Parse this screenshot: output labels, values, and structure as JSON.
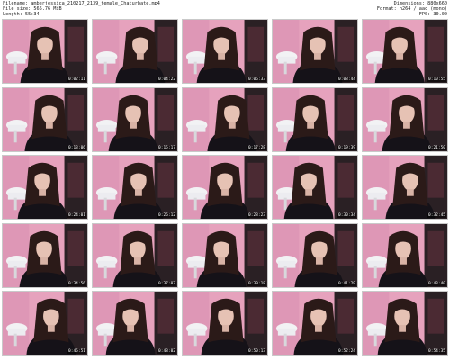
{
  "info": {
    "filename": "Filename: amberjessica_210217_2139_female_Chaturbate.mp4",
    "filesize": "File size: 566.76 MiB",
    "length": "Length: 55:34",
    "dimensions": "Dimensions: 880x660",
    "format": "Format: h264 / aac (mono)",
    "fps": "FPS: 30.00"
  },
  "thumbnails": [
    {
      "time": "0:02:11"
    },
    {
      "time": "0:04:22"
    },
    {
      "time": "0:06:33"
    },
    {
      "time": "0:08:44"
    },
    {
      "time": "0:10:55"
    },
    {
      "time": "0:13:06"
    },
    {
      "time": "0:15:17"
    },
    {
      "time": "0:17:28"
    },
    {
      "time": "0:19:39"
    },
    {
      "time": "0:21:50"
    },
    {
      "time": "0:24:01"
    },
    {
      "time": "0:26:12"
    },
    {
      "time": "0:28:23"
    },
    {
      "time": "0:30:34"
    },
    {
      "time": "0:32:45"
    },
    {
      "time": "0:34:56"
    },
    {
      "time": "0:37:07"
    },
    {
      "time": "0:39:18"
    },
    {
      "time": "0:41:29"
    },
    {
      "time": "0:43:40"
    },
    {
      "time": "0:45:51"
    },
    {
      "time": "0:48:02"
    },
    {
      "time": "0:50:13"
    },
    {
      "time": "0:52:24"
    },
    {
      "time": "0:54:35"
    }
  ]
}
